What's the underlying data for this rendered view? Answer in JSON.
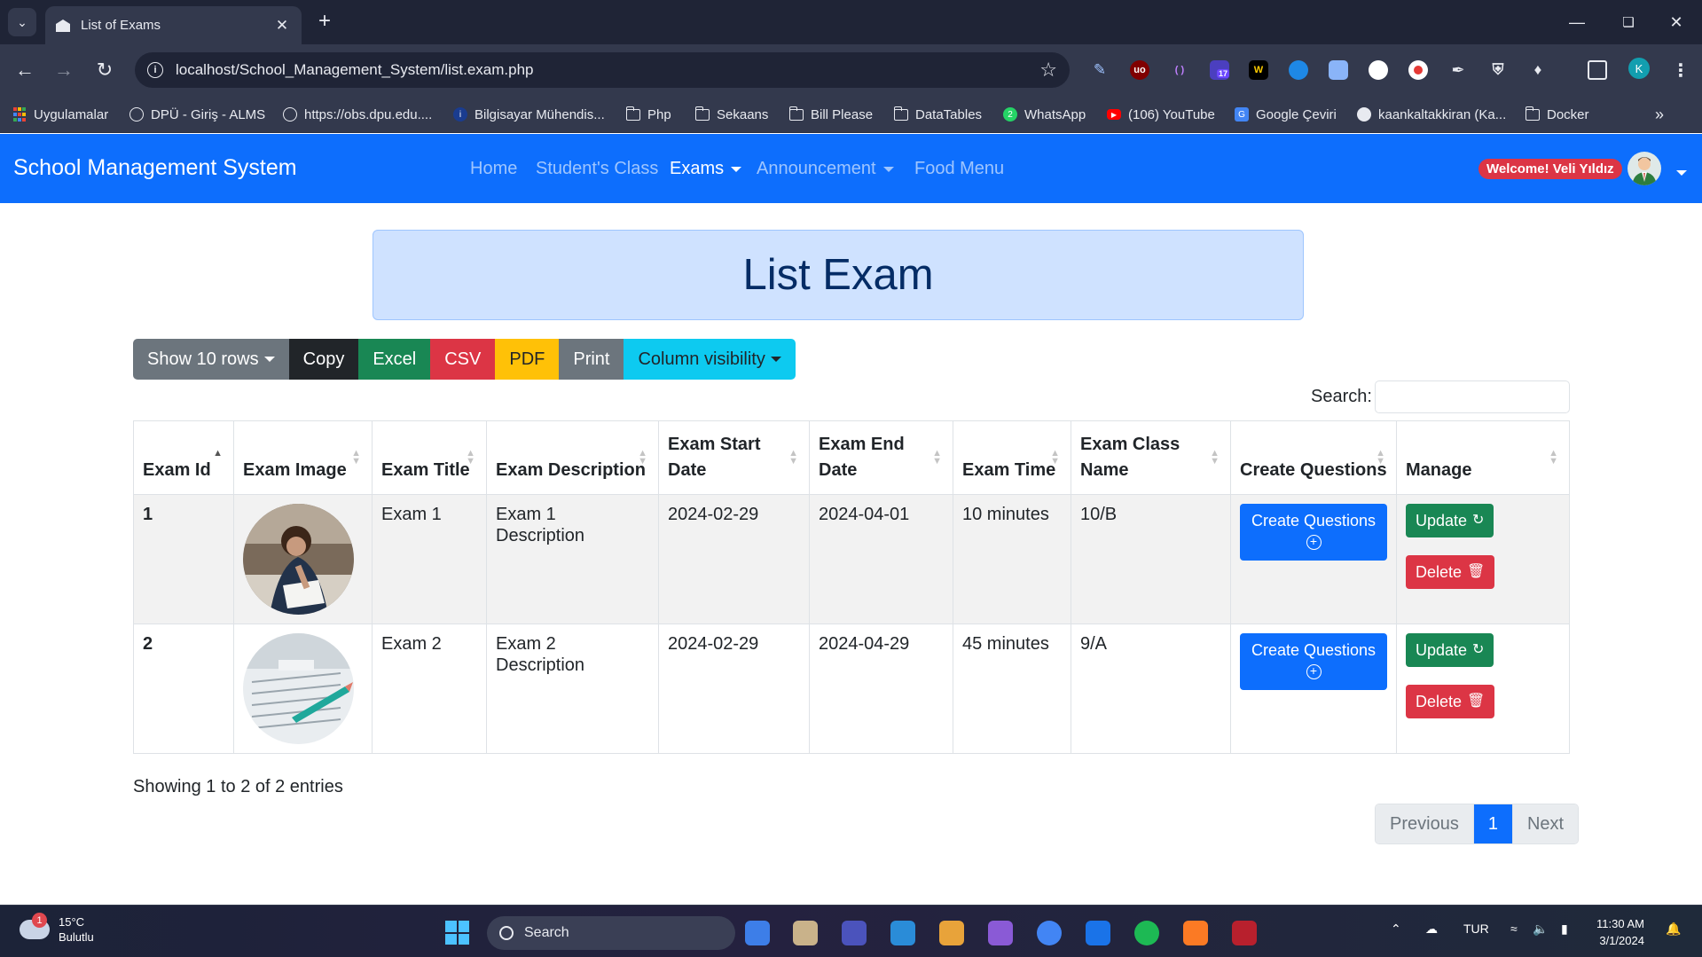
{
  "browser": {
    "tab_title": "List of Exams",
    "url": "localhost/School_Management_System/list.exam.php",
    "bookmarks": [
      "Uygulamalar",
      "DPÜ - Giriş - ALMS",
      "https://obs.dpu.edu....",
      "Bilgisayar Mühendis...",
      "Php",
      "Sekaans",
      "Bill Please",
      "DataTables",
      "WhatsApp",
      "(106) YouTube",
      "Google Çeviri",
      "kaankaltakkiran (Ka...",
      "Docker"
    ],
    "profile_initial": "K",
    "ext_badge": "17"
  },
  "navbar": {
    "brand": "School Management System",
    "links": [
      "Home",
      "Student's Class",
      "Exams",
      "Announcement",
      "Food Menu"
    ],
    "active_link": "Exams",
    "welcome": "Welcome! Veli Yıldız",
    "colors": {
      "navbar": "#0d6efd",
      "welcome_badge": "#dc3545"
    }
  },
  "page": {
    "title": "List Exam"
  },
  "toolbar_buttons": {
    "show_rows": "Show 10 rows",
    "copy": "Copy",
    "excel": "Excel",
    "csv": "CSV",
    "pdf": "PDF",
    "print": "Print",
    "column_visibility": "Column visibility",
    "colors": {
      "show_rows": "#6c757d",
      "copy": "#212529",
      "excel": "#198754",
      "csv": "#dc3545",
      "pdf": "#ffc107",
      "print": "#6c757d",
      "column_visibility": "#0dcaf0"
    }
  },
  "search": {
    "label": "Search:",
    "value": ""
  },
  "table": {
    "headers": [
      "Exam Id",
      "Exam Image",
      "Exam Title",
      "Exam Description",
      "Exam Start Date",
      "Exam End Date",
      "Exam Time",
      "Exam Class Name",
      "Create Questions",
      "Manage"
    ],
    "rows": [
      {
        "id": "1",
        "title": "Exam 1",
        "description": "Exam 1 Description",
        "start": "2024-02-29",
        "end": "2024-04-01",
        "time": "10 minutes",
        "class_name": "10/B"
      },
      {
        "id": "2",
        "title": "Exam 2",
        "description": "Exam 2 Description",
        "start": "2024-02-29",
        "end": "2024-04-29",
        "time": "45 minutes",
        "class_name": "9/A"
      }
    ],
    "create_questions_label": "Create Questions",
    "update_label": "Update",
    "delete_label": "Delete"
  },
  "footer": {
    "info": "Showing 1 to 2 of 2 entries",
    "previous": "Previous",
    "current_page": "1",
    "next": "Next"
  },
  "taskbar": {
    "temperature": "15°C",
    "weather": "Bulutlu",
    "weather_badge": "1",
    "search": "Search",
    "language": "TUR",
    "time": "11:30 AM",
    "date": "3/1/2024"
  }
}
